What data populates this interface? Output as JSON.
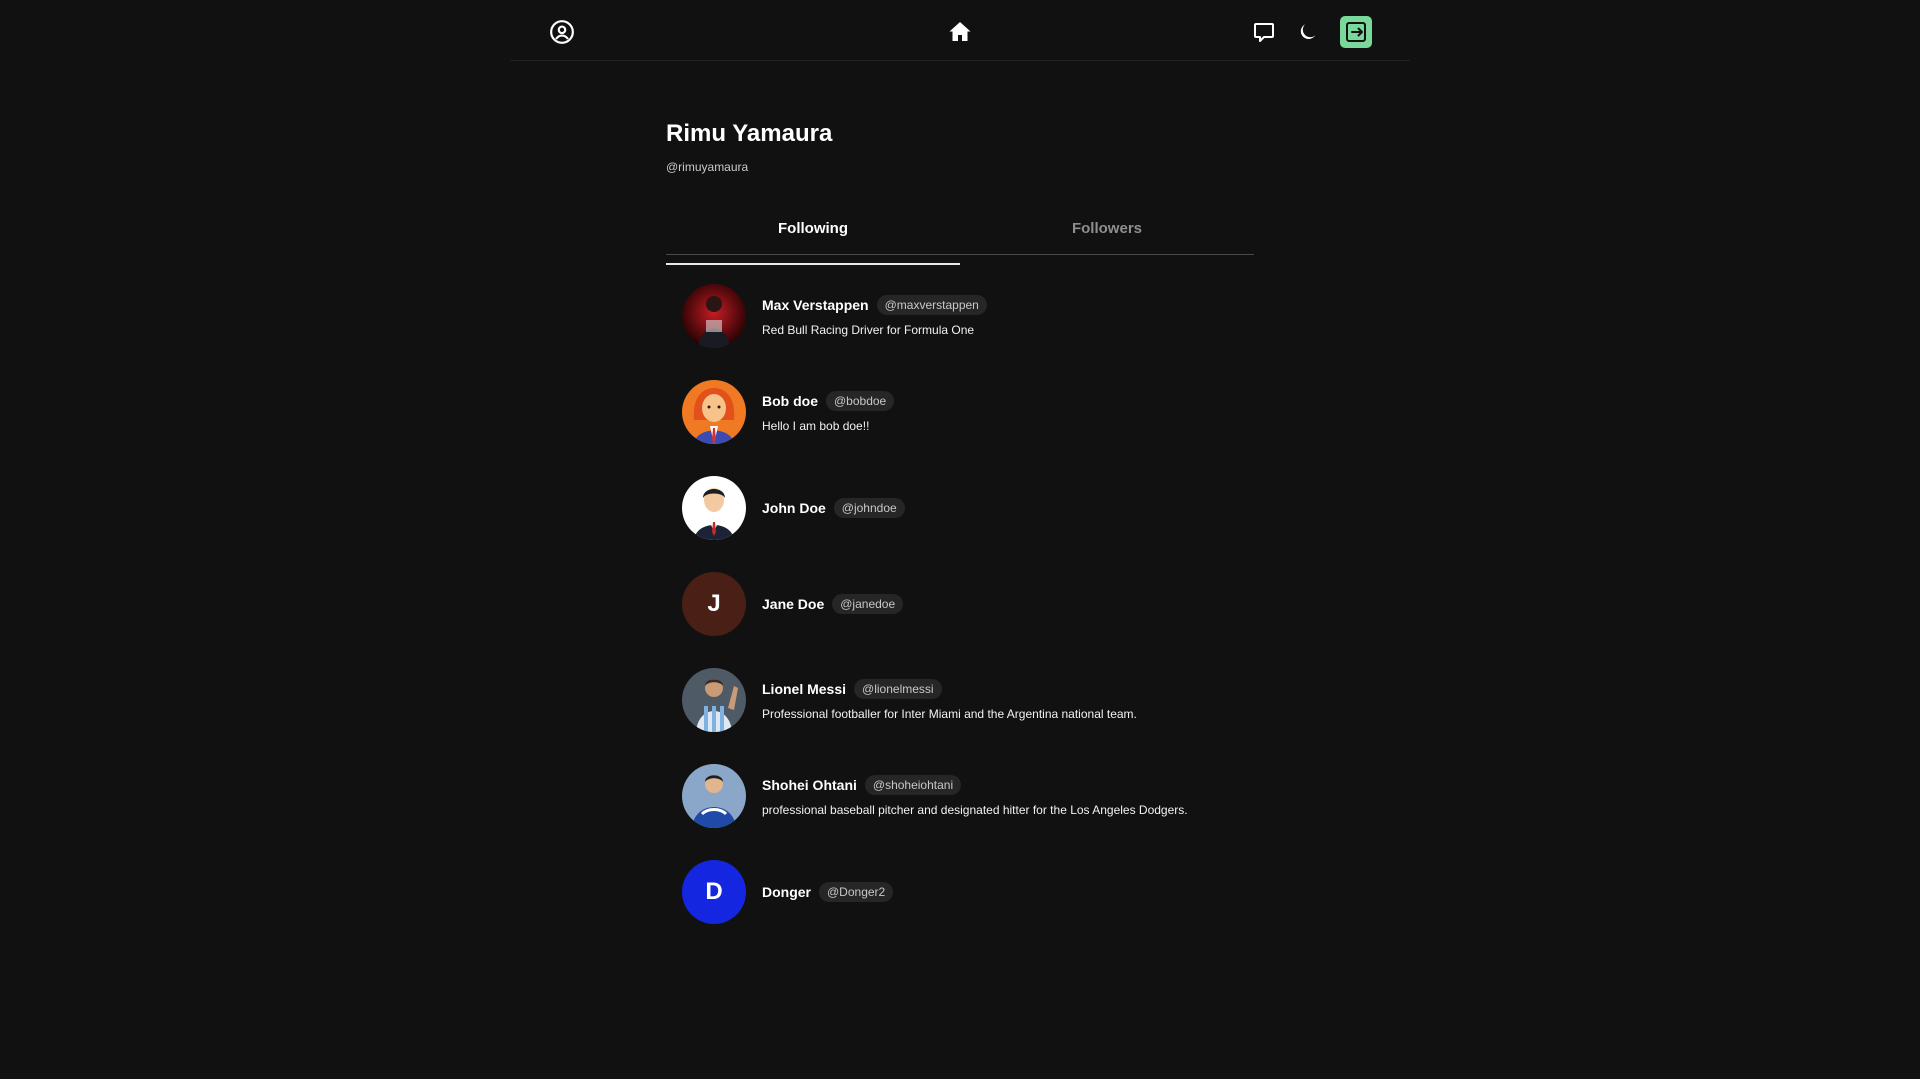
{
  "nav": {
    "profile_icon": "user-circle-icon",
    "home_icon": "home-icon",
    "chat_icon": "chat-bubble-icon",
    "theme_icon": "moon-icon",
    "logout_icon": "logout-icon",
    "logout_color": "#7ad89a"
  },
  "profile": {
    "name": "Rimu Yamaura",
    "handle": "@rimuyamaura"
  },
  "tabs": [
    {
      "label": "Following",
      "active": true
    },
    {
      "label": "Followers",
      "active": false
    }
  ],
  "following": [
    {
      "name": "Max Verstappen",
      "handle": "@maxverstappen",
      "bio": "Red Bull Racing Driver for Formula One",
      "avatar_type": "photo",
      "avatar_color": "#7a0f14"
    },
    {
      "name": "Bob doe",
      "handle": "@bobdoe",
      "bio": "Hello I am bob doe!!",
      "avatar_type": "illustration",
      "avatar_color": "#f07a24"
    },
    {
      "name": "John Doe",
      "handle": "@johndoe",
      "bio": "",
      "avatar_type": "illustration",
      "avatar_color": "#ffffff"
    },
    {
      "name": "Jane Doe",
      "handle": "@janedoe",
      "bio": "",
      "avatar_type": "initial",
      "initial": "J",
      "avatar_color": "#4a2016"
    },
    {
      "name": "Lionel Messi",
      "handle": "@lionelmessi",
      "bio": "Professional footballer for Inter Miami and the Argentina national team.",
      "avatar_type": "photo",
      "avatar_color": "#6f8fb0"
    },
    {
      "name": "Shohei Ohtani",
      "handle": "@shoheiohtani",
      "bio": "professional baseball pitcher and designated hitter for the Los Angeles Dodgers.",
      "avatar_type": "photo",
      "avatar_color": "#2450a6"
    },
    {
      "name": "Donger",
      "handle": "@Donger2",
      "bio": "",
      "avatar_type": "initial",
      "initial": "D",
      "avatar_color": "#1526e0"
    }
  ]
}
